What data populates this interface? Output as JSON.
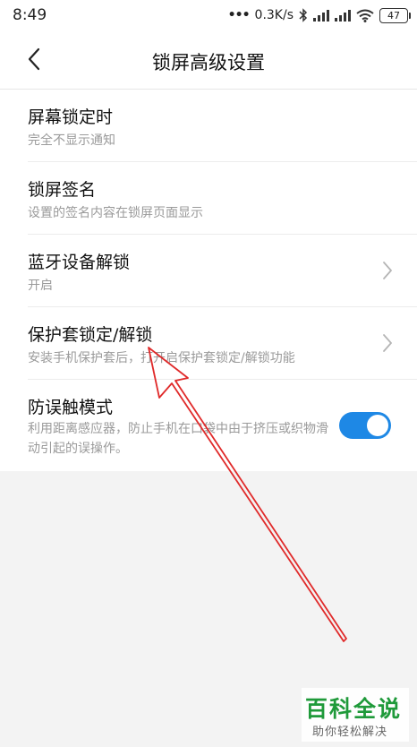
{
  "status_bar": {
    "time": "8:49",
    "network_speed": "0.3K/s",
    "battery": "47",
    "icons": [
      "bluetooth-icon",
      "signal-icon",
      "signal-icon",
      "wifi-icon",
      "battery-icon"
    ]
  },
  "header": {
    "title": "锁屏高级设置",
    "back_icon": "back-chevron-icon"
  },
  "settings": [
    {
      "title": "屏幕锁定时",
      "desc": "完全不显示通知",
      "has_chevron": false
    },
    {
      "title": "锁屏签名",
      "desc": "设置的签名内容在锁屏页面显示",
      "has_chevron": false
    },
    {
      "title": "蓝牙设备解锁",
      "desc": "开启",
      "has_chevron": true
    },
    {
      "title": "保护套锁定/解锁",
      "desc": "安装手机保护套后，打开启保护套锁定/解锁功能",
      "has_chevron": true
    },
    {
      "title": "防误触模式",
      "desc": "利用距离感应器，防止手机在口袋中由于挤压或织物滑动引起的误操作。",
      "toggle_on": true
    }
  ],
  "annotation": {
    "arrow_color": "#e02a2a"
  },
  "watermark": {
    "brand": "百科全说",
    "slogan": "助你轻松解决",
    "color": "#1f9a3a"
  },
  "colors": {
    "accent": "#1e88e5"
  }
}
